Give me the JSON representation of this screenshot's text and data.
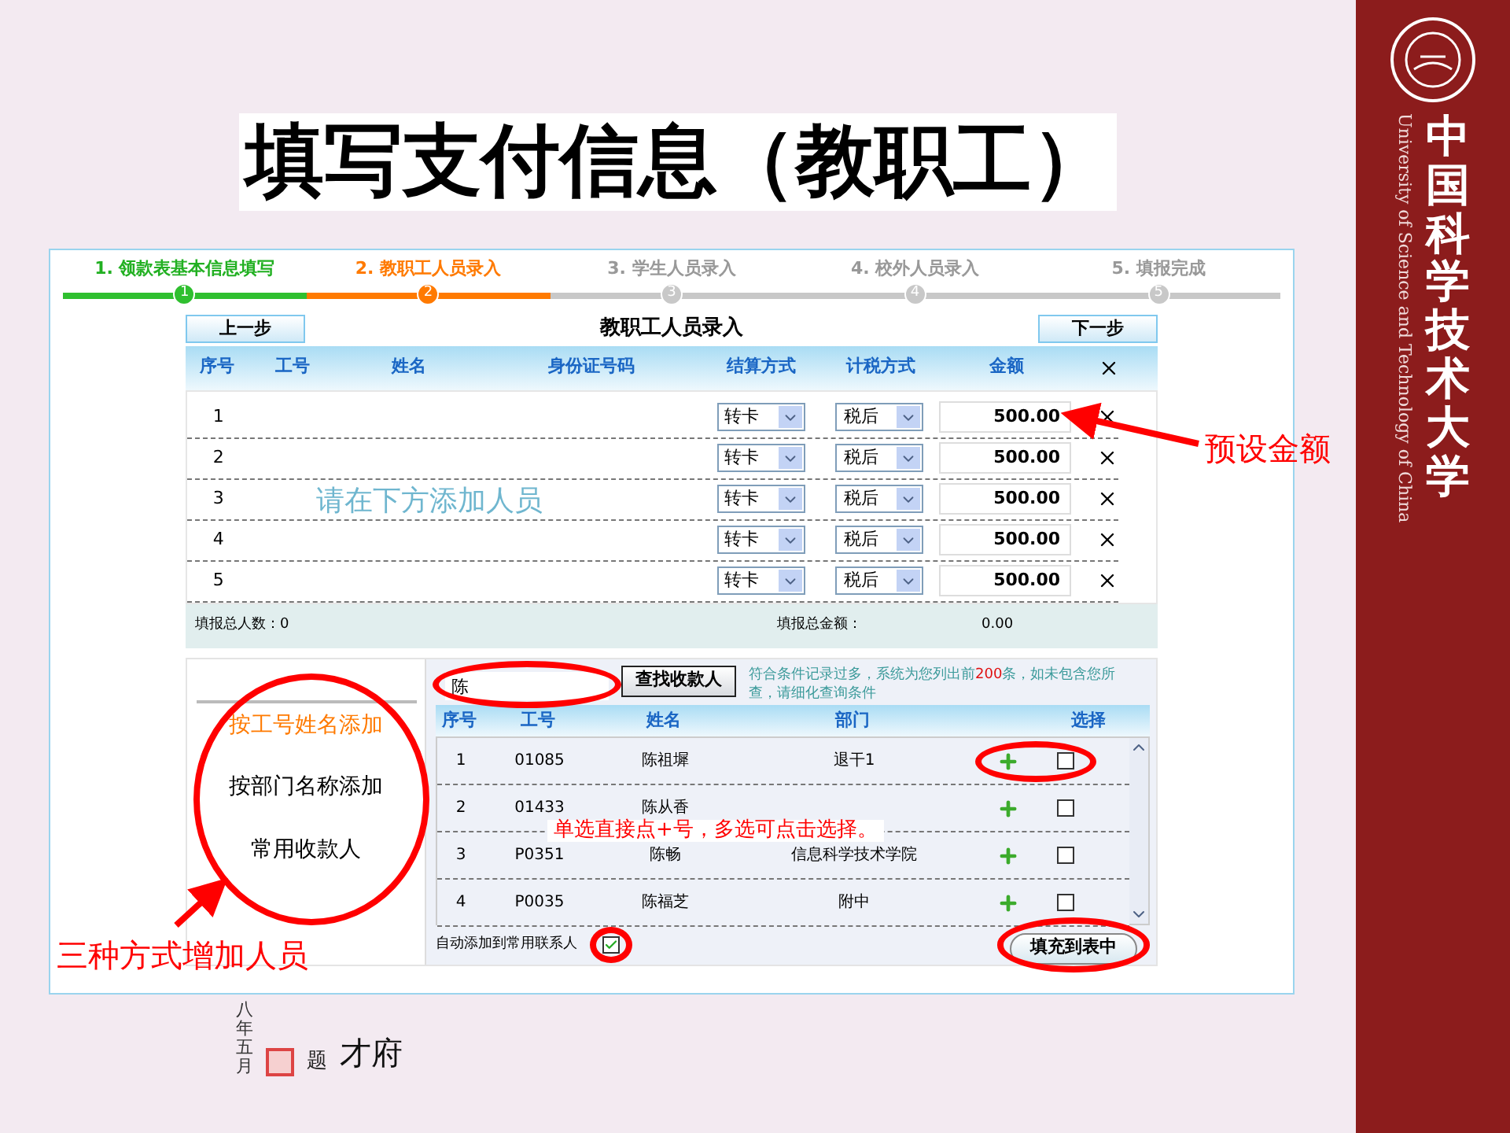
{
  "slide": {
    "title": "填写支付信息（教职工）"
  },
  "brand": {
    "name_zh": "中国科学技术大学",
    "name_en": "University of Science and Technology of China"
  },
  "calligraphy": {
    "date": "八年五月",
    "label": "题",
    "signature": "才府"
  },
  "steps": [
    {
      "label": "1. 领款表基本信息填写",
      "number": "1",
      "done": true,
      "current": false
    },
    {
      "label": "2. 教职工人员录入",
      "number": "2",
      "done": false,
      "current": true
    },
    {
      "label": "3. 学生人员录入",
      "number": "3",
      "done": false,
      "current": false
    },
    {
      "label": "4. 校外人员录入",
      "number": "4",
      "done": false,
      "current": false
    },
    {
      "label": "5. 填报完成",
      "number": "5",
      "done": false,
      "current": false
    }
  ],
  "form": {
    "prev_button": "上一步",
    "title": "教职工人员录入",
    "next_button": "下一步",
    "columns": [
      "序号",
      "工号",
      "姓名",
      "身份证号码",
      "结算方式",
      "计税方式",
      "金额"
    ],
    "rows": [
      {
        "index": "1",
        "settlement": "转卡",
        "tax": "税后",
        "amount": "500.00"
      },
      {
        "index": "2",
        "settlement": "转卡",
        "tax": "税后",
        "amount": "500.00"
      },
      {
        "index": "3",
        "settlement": "转卡",
        "tax": "税后",
        "amount": "500.00"
      },
      {
        "index": "4",
        "settlement": "转卡",
        "tax": "税后",
        "amount": "500.00"
      },
      {
        "index": "5",
        "settlement": "转卡",
        "tax": "税后",
        "amount": "500.00"
      }
    ],
    "empty_hint": "请在下方添加人员",
    "total_count": "填报总人数：0",
    "total_amount_label": "填报总金额：",
    "total_amount": "0.00"
  },
  "add_panel": {
    "methods": [
      {
        "label": "按工号姓名添加",
        "selected": true
      },
      {
        "label": "按部门名称添加",
        "selected": false
      },
      {
        "label": "常用收款人",
        "selected": false
      }
    ],
    "search": {
      "value": "陈"
    },
    "search_button": "查找收款人",
    "notice": {
      "before": "符合条件记录过多，系统为您列出前",
      "count": "200",
      "after": "条，如未包含您所查，请细化查询条件"
    },
    "columns": [
      "序号",
      "工号",
      "姓名",
      "部门",
      "选择"
    ],
    "rows": [
      {
        "index": "1",
        "id": "01085",
        "name": "陈祖墀",
        "dept": "退干1",
        "checked": false
      },
      {
        "index": "2",
        "id": "01433",
        "name": "陈从香",
        "dept": "",
        "checked": false
      },
      {
        "index": "3",
        "id": "P0351",
        "name": "陈畅",
        "dept": "信息科学技术学院",
        "checked": false
      },
      {
        "index": "4",
        "id": "P0035",
        "name": "陈福芝",
        "dept": "附中",
        "checked": false
      }
    ],
    "auto_add": {
      "label": "自动添加到常用联系人",
      "checked": true
    },
    "fill_button": "填充到表中"
  },
  "annotations": {
    "preset_amount": "预设金额",
    "three_ways": "三种方式增加人员",
    "select_hint": "单选直接点+号，多选可点击选择。"
  }
}
